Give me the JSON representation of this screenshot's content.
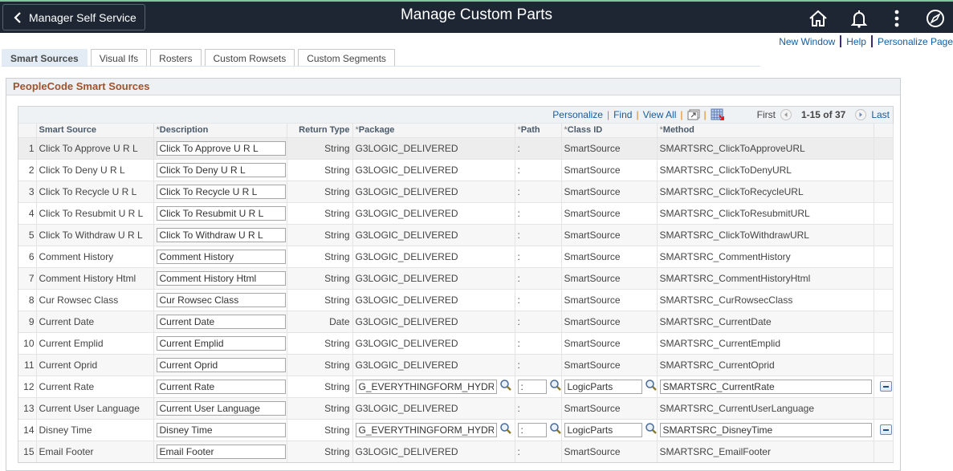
{
  "header": {
    "back_label": "Manager Self Service",
    "title": "Manage Custom Parts",
    "icons": [
      "home-icon",
      "notification-bell-icon",
      "actions-menu-icon",
      "navbar-compass-icon"
    ]
  },
  "page_links": {
    "new_window": "New Window",
    "help": "Help",
    "personalize_page": "Personalize Page"
  },
  "tabs": [
    {
      "label": "Smart Sources",
      "active": true
    },
    {
      "label": "Visual Ifs",
      "active": false
    },
    {
      "label": "Rosters",
      "active": false
    },
    {
      "label": "Custom Rowsets",
      "active": false
    },
    {
      "label": "Custom Segments",
      "active": false
    }
  ],
  "groupbox": {
    "title": "PeopleCode Smart Sources"
  },
  "grid": {
    "nav": {
      "personalize": "Personalize",
      "find": "Find",
      "view_all": "View All",
      "first": "First",
      "range": "1-15 of 37",
      "last": "Last"
    },
    "columns": [
      {
        "label": "",
        "required": false
      },
      {
        "label": "Smart Source",
        "required": false
      },
      {
        "label": "Description",
        "required": true
      },
      {
        "label": "Return Type",
        "required": false
      },
      {
        "label": "Package",
        "required": true
      },
      {
        "label": "Path",
        "required": true
      },
      {
        "label": "Class ID",
        "required": true
      },
      {
        "label": "Method",
        "required": true
      }
    ],
    "rows": [
      {
        "num": "1",
        "source": "Click To Approve U R L",
        "description": "Click To Approve U R L",
        "return_type": "String",
        "package": "G3LOGIC_DELIVERED",
        "path": ":",
        "class_id": "SmartSource",
        "method": "SMARTSRC_ClickToApproveURL",
        "editable": false
      },
      {
        "num": "2",
        "source": "Click To Deny U R L",
        "description": "Click To Deny U R L",
        "return_type": "String",
        "package": "G3LOGIC_DELIVERED",
        "path": ":",
        "class_id": "SmartSource",
        "method": "SMARTSRC_ClickToDenyURL",
        "editable": false
      },
      {
        "num": "3",
        "source": "Click To Recycle U R L",
        "description": "Click To Recycle U R L",
        "return_type": "String",
        "package": "G3LOGIC_DELIVERED",
        "path": ":",
        "class_id": "SmartSource",
        "method": "SMARTSRC_ClickToRecycleURL",
        "editable": false
      },
      {
        "num": "4",
        "source": "Click To Resubmit U R L",
        "description": "Click To Resubmit U R L",
        "return_type": "String",
        "package": "G3LOGIC_DELIVERED",
        "path": ":",
        "class_id": "SmartSource",
        "method": "SMARTSRC_ClickToResubmitURL",
        "editable": false
      },
      {
        "num": "5",
        "source": "Click To Withdraw U R L",
        "description": "Click To Withdraw U R L",
        "return_type": "String",
        "package": "G3LOGIC_DELIVERED",
        "path": ":",
        "class_id": "SmartSource",
        "method": "SMARTSRC_ClickToWithdrawURL",
        "editable": false
      },
      {
        "num": "6",
        "source": "Comment History",
        "description": "Comment History",
        "return_type": "String",
        "package": "G3LOGIC_DELIVERED",
        "path": ":",
        "class_id": "SmartSource",
        "method": "SMARTSRC_CommentHistory",
        "editable": false
      },
      {
        "num": "7",
        "source": "Comment History Html",
        "description": "Comment History Html",
        "return_type": "String",
        "package": "G3LOGIC_DELIVERED",
        "path": ":",
        "class_id": "SmartSource",
        "method": "SMARTSRC_CommentHistoryHtml",
        "editable": false
      },
      {
        "num": "8",
        "source": "Cur Rowsec Class",
        "description": "Cur Rowsec Class",
        "return_type": "String",
        "package": "G3LOGIC_DELIVERED",
        "path": ":",
        "class_id": "SmartSource",
        "method": "SMARTSRC_CurRowsecClass",
        "editable": false
      },
      {
        "num": "9",
        "source": "Current Date",
        "description": "Current Date",
        "return_type": "Date",
        "package": "G3LOGIC_DELIVERED",
        "path": ":",
        "class_id": "SmartSource",
        "method": "SMARTSRC_CurrentDate",
        "editable": false
      },
      {
        "num": "10",
        "source": "Current Emplid",
        "description": "Current Emplid",
        "return_type": "String",
        "package": "G3LOGIC_DELIVERED",
        "path": ":",
        "class_id": "SmartSource",
        "method": "SMARTSRC_CurrentEmplid",
        "editable": false
      },
      {
        "num": "11",
        "source": "Current Oprid",
        "description": "Current Oprid",
        "return_type": "String",
        "package": "G3LOGIC_DELIVERED",
        "path": ":",
        "class_id": "SmartSource",
        "method": "SMARTSRC_CurrentOprid",
        "editable": false
      },
      {
        "num": "12",
        "source": "Current Rate",
        "description": "Current Rate",
        "return_type": "String",
        "package": "G_EVERYTHINGFORM_HYDRC",
        "path": ":",
        "class_id": "LogicParts",
        "method": "SMARTSRC_CurrentRate",
        "editable": true
      },
      {
        "num": "13",
        "source": "Current User Language",
        "description": "Current User Language",
        "return_type": "String",
        "package": "G3LOGIC_DELIVERED",
        "path": ":",
        "class_id": "SmartSource",
        "method": "SMARTSRC_CurrentUserLanguage",
        "editable": false
      },
      {
        "num": "14",
        "source": "Disney Time",
        "description": "Disney Time",
        "return_type": "String",
        "package": "G_EVERYTHINGFORM_HYDRC",
        "path": ":",
        "class_id": "LogicParts",
        "method": "SMARTSRC_DisneyTime",
        "editable": true
      },
      {
        "num": "15",
        "source": "Email Footer",
        "description": "Email Footer",
        "return_type": "String",
        "package": "G3LOGIC_DELIVERED",
        "path": ":",
        "class_id": "SmartSource",
        "method": "SMARTSRC_EmailFooter",
        "editable": false
      }
    ]
  },
  "colors": {
    "banner_bg": "#1e2633",
    "link": "#145c9e",
    "groupbox_title": "#a0522d",
    "active_tab_bg": "#e3ecf5"
  }
}
